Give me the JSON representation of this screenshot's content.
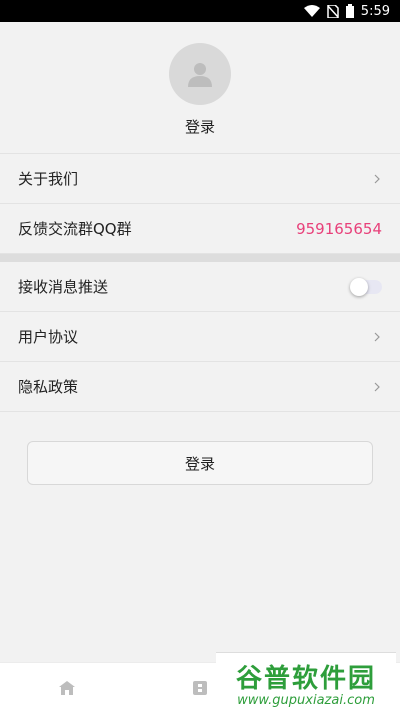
{
  "status_bar": {
    "time": "5:59"
  },
  "profile": {
    "name": "登录"
  },
  "menu_group_1": [
    {
      "label": "关于我们"
    },
    {
      "label": "反馈交流群QQ群",
      "value": "959165654"
    }
  ],
  "menu_group_2": [
    {
      "label": "接收消息推送"
    },
    {
      "label": "用户协议"
    },
    {
      "label": "隐私政策"
    }
  ],
  "login_button": {
    "label": "登录"
  },
  "watermark": {
    "title": "谷普软件园",
    "url": "www.gupuxiazai.com"
  },
  "colors": {
    "accent": "#e8407a",
    "watermark": "#2e9e3b"
  }
}
